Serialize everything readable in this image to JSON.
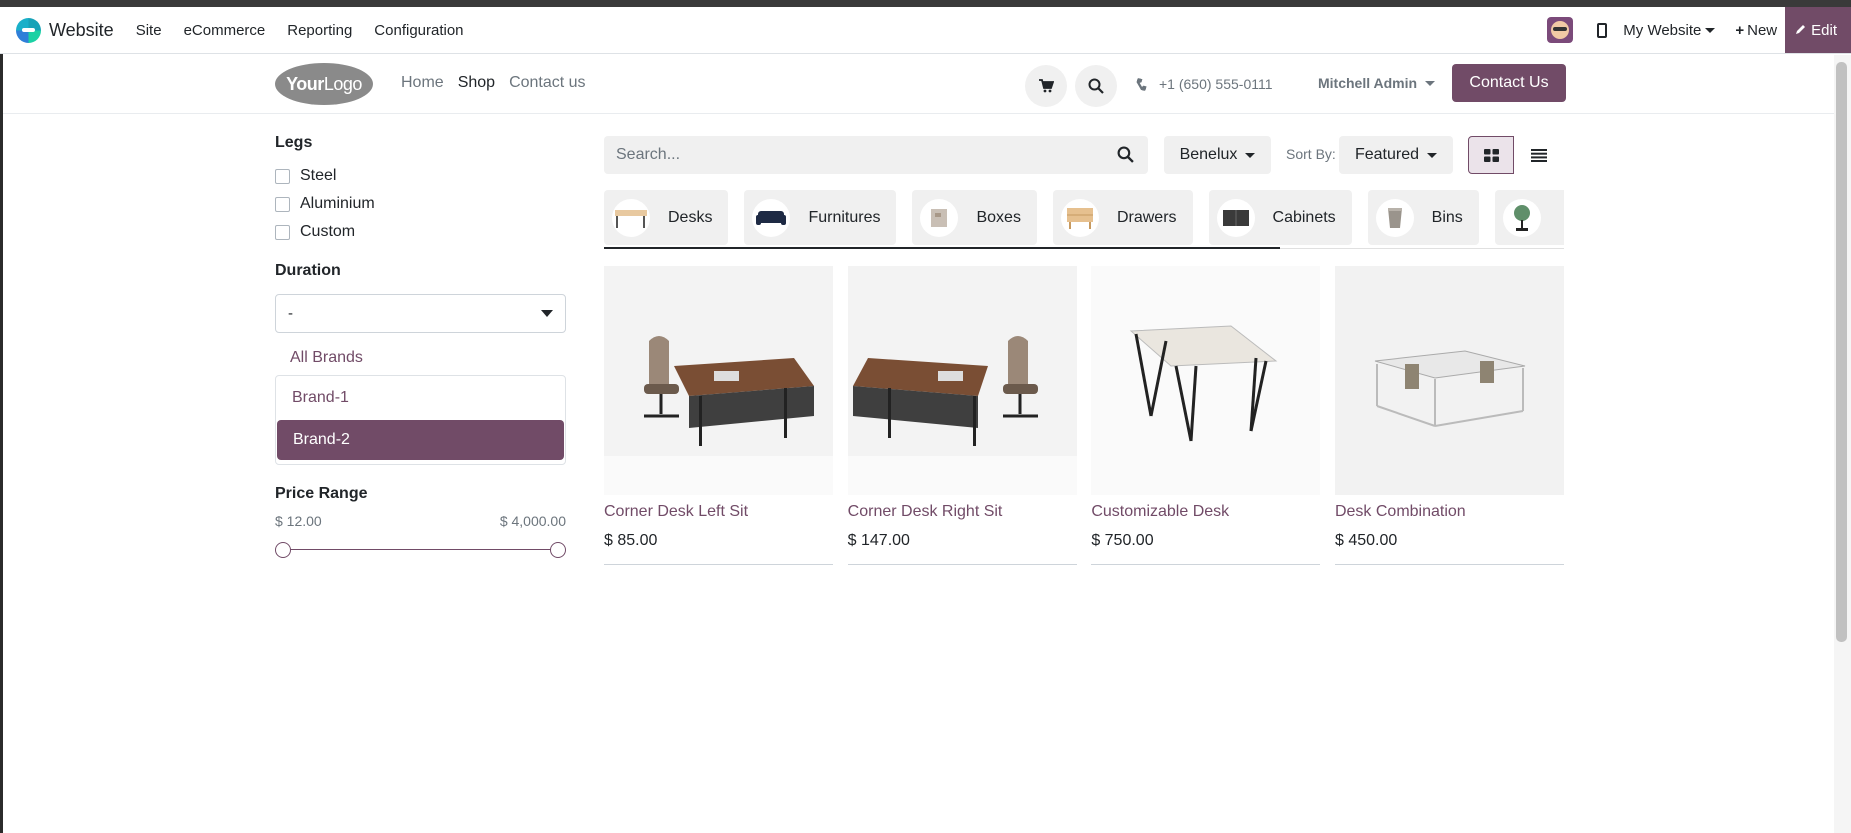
{
  "admin": {
    "brand": "Website",
    "menu": [
      "Site",
      "eCommerce",
      "Reporting",
      "Configuration"
    ],
    "website_switch": "My Website",
    "new_label": "New",
    "edit_label": "Edit"
  },
  "site": {
    "logo_bold": "Your",
    "logo_light": "Logo",
    "nav": [
      "Home",
      "Shop",
      "Contact us"
    ],
    "active_nav": "Shop",
    "phone": "+1 (650) 555-0111",
    "user": "Mitchell Admin",
    "contact_button": "Contact Us"
  },
  "filters": {
    "legs_title": "Legs",
    "legs": [
      "Steel",
      "Aluminium",
      "Custom"
    ],
    "duration_title": "Duration",
    "duration_value": "-",
    "all_brands": "All Brands",
    "brands": [
      "Brand-1",
      "Brand-2"
    ],
    "selected_brand": "Brand-2",
    "price_title": "Price Range",
    "price_min": "$ 12.00",
    "price_max": "$ 4,000.00",
    "price_range_selected": [
      0,
      1
    ]
  },
  "toolbar": {
    "search_placeholder": "Search...",
    "pricelist": "Benelux",
    "sort_label": "Sort By:",
    "sort_value": "Featured",
    "active_view": "grid"
  },
  "categories": [
    "Desks",
    "Furnitures",
    "Boxes",
    "Drawers",
    "Cabinets",
    "Bins"
  ],
  "products": [
    {
      "name": "Corner Desk Left Sit",
      "price": "$ 85.00"
    },
    {
      "name": "Corner Desk Right Sit",
      "price": "$ 147.00"
    },
    {
      "name": "Customizable Desk",
      "price": "$ 750.00"
    },
    {
      "name": "Desk Combination",
      "price": "$ 450.00"
    }
  ],
  "colors": {
    "primary": "#714B67",
    "muted": "#6c757d"
  }
}
